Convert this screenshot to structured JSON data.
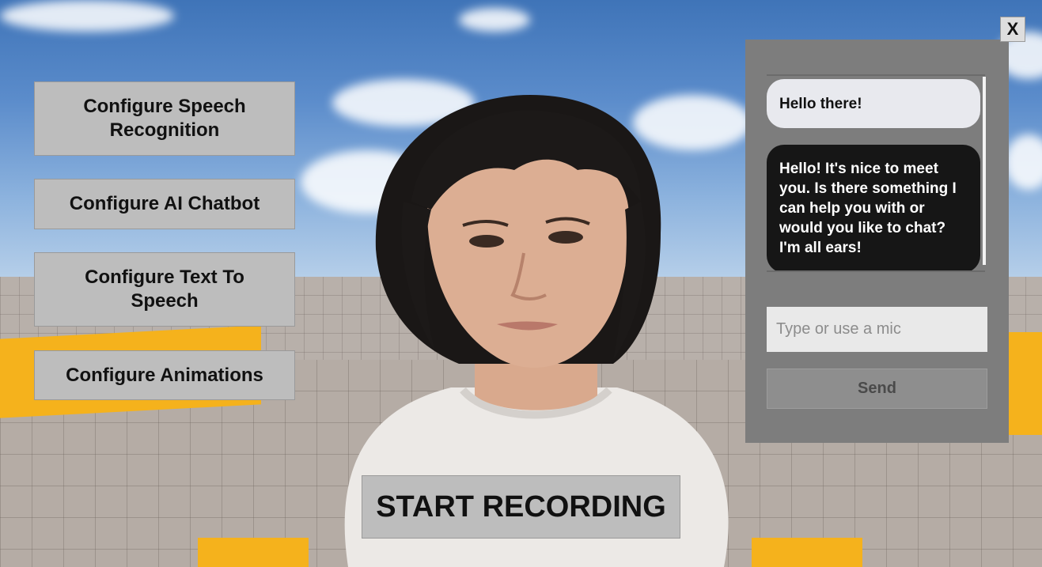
{
  "left_menu": {
    "configure_speech_recognition": "Configure Speech Recognition",
    "configure_ai_chatbot": "Configure AI Chatbot",
    "configure_text_to_speech": "Configure Text To Speech",
    "configure_animations": "Configure Animations"
  },
  "recording": {
    "label": "START RECORDING"
  },
  "chat": {
    "messages": [
      {
        "role": "user",
        "text": "Hello there!"
      },
      {
        "role": "assistant",
        "text": "Hello! It's nice to meet you. Is there something I can help you with or would you like to chat? I'm all ears!"
      }
    ],
    "input": {
      "value": "",
      "placeholder": "Type or use a mic"
    },
    "send_label": "Send"
  },
  "close": {
    "label": "X"
  },
  "colors": {
    "button_bg": "#bdbdbd",
    "panel_bg": "#7d7d7d",
    "user_bubble": "#e8e9ee",
    "assistant_bubble": "#161616",
    "accent_yellow": "#f5b21c"
  }
}
